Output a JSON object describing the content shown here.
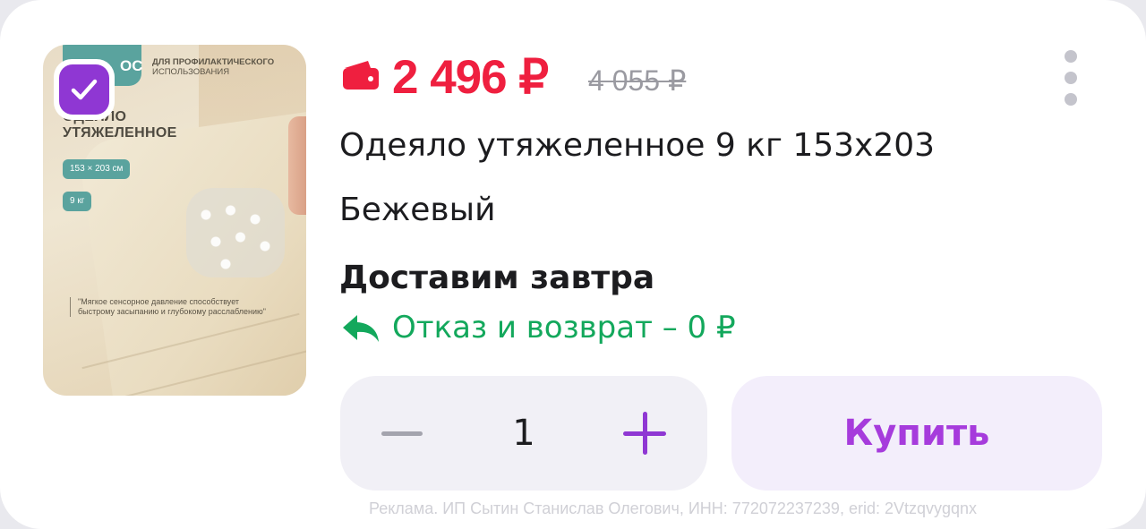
{
  "product_image": {
    "brand_text": "ОС",
    "tagline_line1": "ДЛЯ ПРОФИЛАКТИЧЕСКОГО",
    "tagline_line2": "ИСПОЛЬЗОВАНИЯ",
    "title_line1": "ОДЕЯЛО",
    "title_line2": "УТЯЖЕЛЕННОЕ",
    "size_pill": "153 × 203 см",
    "weight_pill": "9 кг",
    "quote": "\"Мягкое сенсорное давление способствует быстрому засыпанию и глубокому расслаблению\"",
    "accent_color": "#5aa39e"
  },
  "selection": {
    "checked": true,
    "icon": "checkmark-icon",
    "color": "#8f37d3"
  },
  "price": {
    "current": "2 496 ₽",
    "old": "4 055 ₽",
    "icon": "wallet-icon",
    "current_color": "#ef1f3f"
  },
  "product": {
    "title": "Одеяло утяжеленное 9 кг 153х203",
    "color": "Бежевый"
  },
  "delivery": {
    "text": "Доставим завтра"
  },
  "return_policy": {
    "text": "Отказ и возврат – 0 ₽",
    "icon": "return-arrow-icon",
    "color": "#13a85c"
  },
  "quantity": {
    "value": "1",
    "minus_icon": "minus-icon",
    "plus_icon": "plus-icon"
  },
  "buy_button": {
    "label": "Купить",
    "color": "#a63bdc"
  },
  "menu": {
    "icon": "more-vertical-icon"
  },
  "ad_disclaimer": "Реклама. ИП Сытин Станислав Олегович, ИНН: 772072237239, erid: 2Vtzqvygqnx"
}
